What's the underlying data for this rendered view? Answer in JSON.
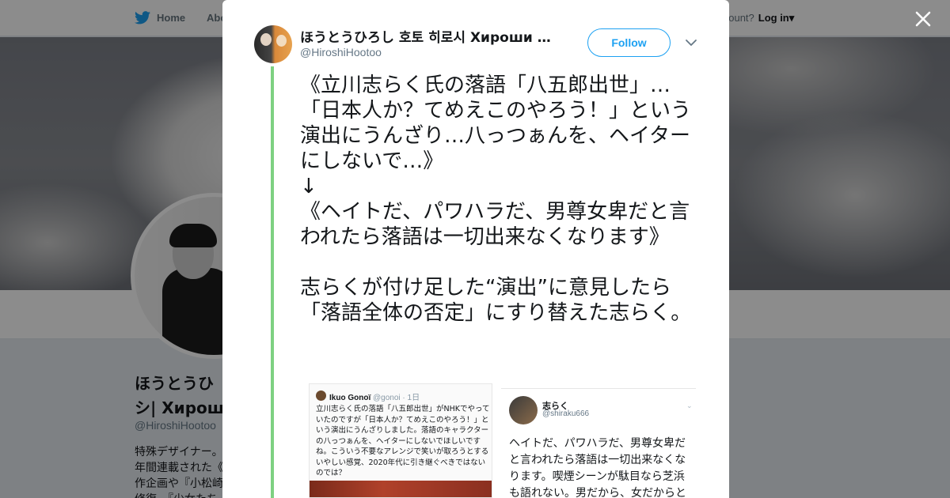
{
  "topnav": {
    "home_label": "Home",
    "about_label": "Abo",
    "account_prompt": "account?",
    "login_label": "Log in",
    "login_caret": "▾"
  },
  "profile": {
    "name_line1": "ほうとうひ",
    "name_line2": "シ| Хироши",
    "handle": "@HiroshiHootoo",
    "bio_lines": [
      "特殊デザイナー。",
      "年間連載された《",
      "作企画や『小松崎",
      "修復、『少女たち"
    ]
  },
  "modal": {
    "close_glyph": "×",
    "author": {
      "name": "ほうとうひろし 호토 히로시 Хироши Хотоо",
      "handle": "@HiroshiHootoo"
    },
    "follow_label": "Follow",
    "tweet_text": "《立川志らく氏の落語「八五郎出世」…「日本人か？てめえこのやろう！」という演出にうんざり…八っつぁんを、ヘイターにしないで…》\n↓\n《ヘイトだ、パワハラだ、男尊女卑だと言われたら落語は一切出来なくなります》\n\n志らくが付け足した“演出”に意見したら「落語全体の否定」にすり替えた志らく。",
    "embedded_left": {
      "user": "Ikuo Gonoï",
      "meta": "@gonoi · 1日",
      "text": "立川志らく氏の落語「八五郎出世」がNHKでやっていたのですが「日本人か？てめえこのやろう！」という演出にうんざりしました。落語のキャラクターの八っつぁんを、ヘイターにしないでほしいですね。こういう不要なアレンジで笑いが取ろうとするいやしい感覚、2020年代に引き継ぐべきではないのでは？"
    },
    "embedded_right": {
      "name": "志らく",
      "handle": "@shiraku666",
      "caret": "⌄",
      "text": "ヘイトだ、パワハラだ、男尊女卑だと言われたら落語は一切出来なくなります。喫煙シーンが駄目なら芝浜も語れない。男だから、女だからと"
    }
  },
  "colors": {
    "accent": "#1da1f2",
    "thread_bar": "#7ed181",
    "overlay": "rgba(0,0,0,0.45)"
  }
}
